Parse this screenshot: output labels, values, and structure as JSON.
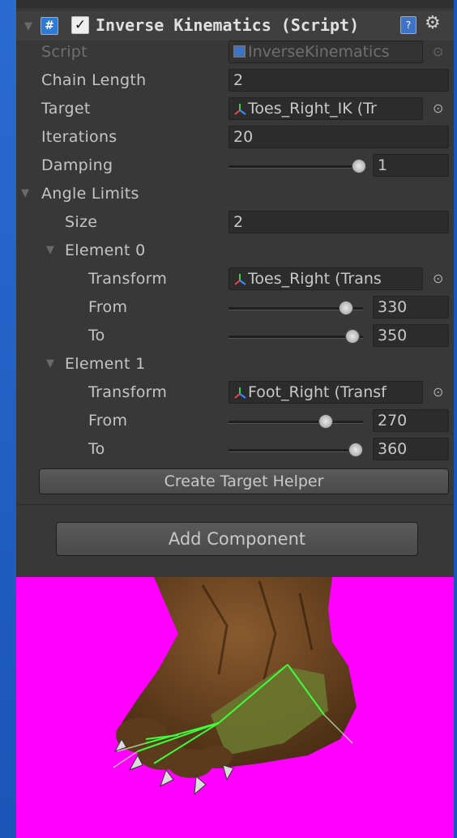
{
  "component": {
    "title": "Inverse Kinematics (Script)",
    "enabled": true
  },
  "fields": {
    "script_label": "Script",
    "script_value": "InverseKinematics",
    "chain_length_label": "Chain Length",
    "chain_length_value": "2",
    "target_label": "Target",
    "target_value": "Toes_Right_IK (Tr",
    "iterations_label": "Iterations",
    "iterations_value": "20",
    "damping_label": "Damping",
    "damping_value": "1",
    "damping_fraction": 1.0
  },
  "angle_limits": {
    "label": "Angle Limits",
    "size_label": "Size",
    "size_value": "2",
    "elements": [
      {
        "label": "Element 0",
        "transform_label": "Transform",
        "transform_value": "Toes_Right (Trans",
        "from_label": "From",
        "from_value": "330",
        "from_fraction": 0.917,
        "to_label": "To",
        "to_value": "350",
        "to_fraction": 0.972
      },
      {
        "label": "Element 1",
        "transform_label": "Transform",
        "transform_value": "Foot_Right (Transf",
        "from_label": "From",
        "from_value": "270",
        "from_fraction": 0.75,
        "to_label": "To",
        "to_value": "360",
        "to_fraction": 1.0
      }
    ]
  },
  "buttons": {
    "create_target_helper": "Create Target Helper",
    "add_component": "Add Component"
  },
  "colors": {
    "panel": "#383838",
    "scene_background": "#ff00ff",
    "bone_gizmo": "#3cff3c"
  },
  "icons": [
    "script-icon",
    "checkbox-icon",
    "help-book-icon",
    "gear-icon",
    "object-picker-icon",
    "transform-icon",
    "foldout-arrow-icon"
  ]
}
